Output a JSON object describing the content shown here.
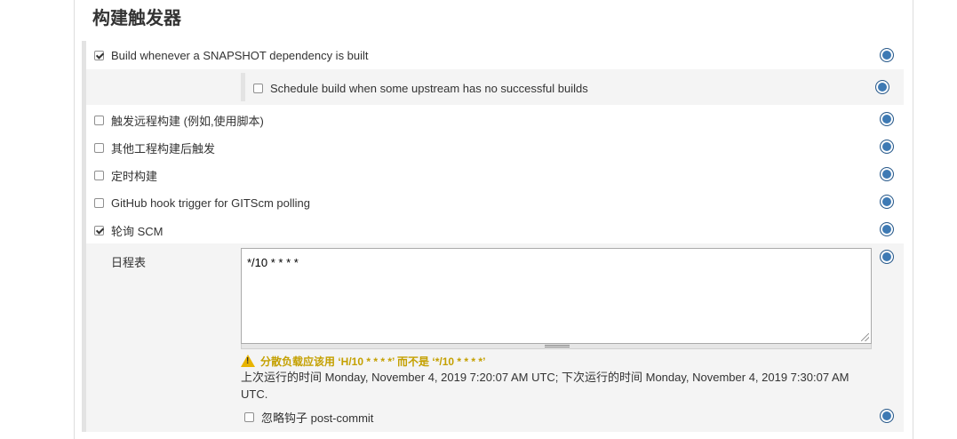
{
  "section": {
    "title": "构建触发器"
  },
  "triggers": {
    "snapshot": {
      "label": "Build whenever a SNAPSHOT dependency is built",
      "checked": true
    },
    "upstream": {
      "label": "Schedule build when some upstream has no successful builds",
      "checked": false
    },
    "remote": {
      "label": "触发远程构建 (例如,使用脚本)",
      "checked": false
    },
    "after_other": {
      "label": "其他工程构建后触发",
      "checked": false
    },
    "timer": {
      "label": "定时构建",
      "checked": false
    },
    "github": {
      "label": "GitHub hook trigger for GITScm polling",
      "checked": false
    },
    "poll_scm": {
      "label": "轮询 SCM",
      "checked": true
    }
  },
  "schedule": {
    "label": "日程表",
    "value": "*/10 * * * *",
    "warning": "分散负载应该用 ‘H/10 * * * *’ 而不是 ‘*/10 * * * *’",
    "info": "上次运行的时间 Monday, November 4, 2019 7:20:07 AM UTC; 下次运行的时间 Monday, November 4, 2019 7:30:07 AM UTC.",
    "ignore_hooks": {
      "label": "忽略钩子 post-commit",
      "checked": false
    }
  },
  "help": {
    "symbol": "?"
  },
  "colors": {
    "help_icon": "#3e7ab4",
    "warning_text": "#c4a000",
    "section_bg": "#f4f4f4"
  }
}
